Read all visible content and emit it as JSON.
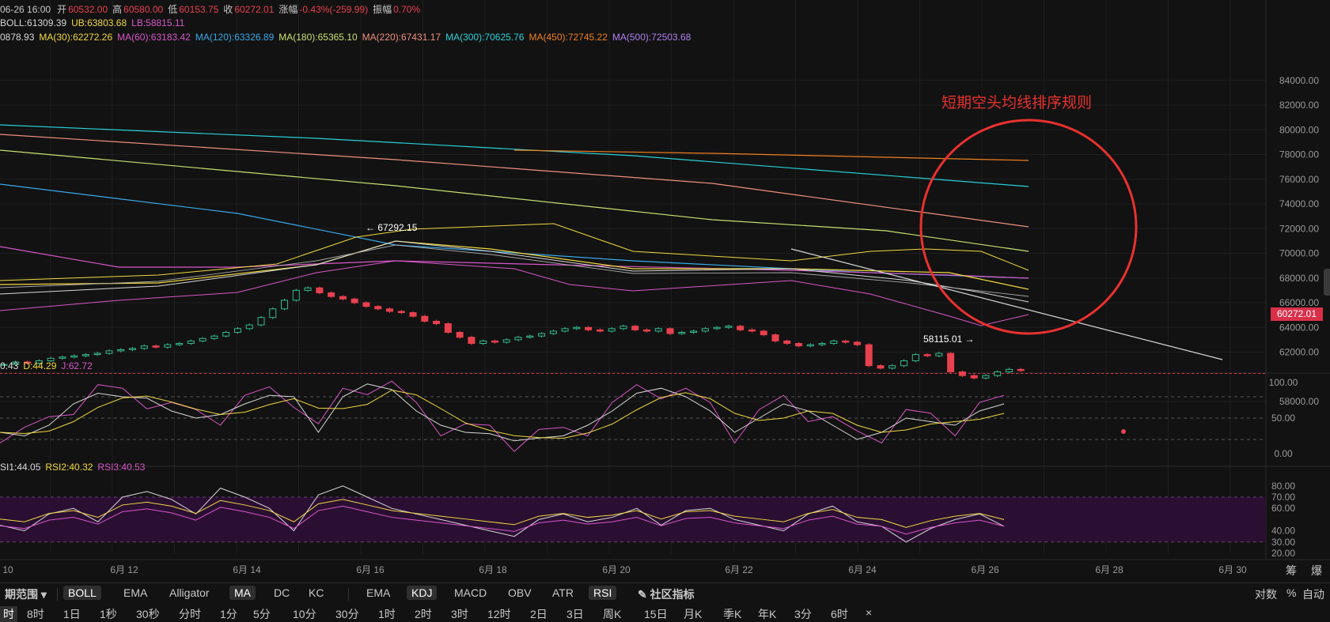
{
  "header": {
    "ohlc": [
      {
        "label": "06-26 16:00",
        "value": ""
      },
      {
        "label": "开",
        "value": "60532.00"
      },
      {
        "label": "高",
        "value": "60580.00"
      },
      {
        "label": "低",
        "value": "60153.75"
      },
      {
        "label": "收",
        "value": "60272.01"
      },
      {
        "label": "涨幅",
        "value": "-0.43%(-259.99)"
      },
      {
        "label": "振幅",
        "value": "0.70%"
      }
    ],
    "boll": [
      {
        "text": "BOLL:61309.39",
        "color": "#d8d8d8"
      },
      {
        "text": "UB:63803.68",
        "color": "#f0d840"
      },
      {
        "text": "LB:58815.11",
        "color": "#d857c8"
      }
    ],
    "ma": [
      {
        "text": "0878.93",
        "color": "#d8d8d8"
      },
      {
        "text": "MA(30):62272.26",
        "color": "#f0d840"
      },
      {
        "text": "MA(60):63183.42",
        "color": "#d857c8"
      },
      {
        "text": "MA(120):63326.89",
        "color": "#3aa8e8"
      },
      {
        "text": "MA(180):65365.10",
        "color": "#c8e070"
      },
      {
        "text": "MA(220):67431.17",
        "color": "#f09080"
      },
      {
        "text": "MA(300):70625.76",
        "color": "#28d0d8"
      },
      {
        "text": "MA(450):72745.22",
        "color": "#f08020"
      },
      {
        "text": "MA(500):72503.68",
        "color": "#b080f0"
      }
    ]
  },
  "kdj_legend": [
    {
      "text": "0.43",
      "color": "#d8d8d8"
    },
    {
      "text": "D:44.29",
      "color": "#f0d840"
    },
    {
      "text": "J:62.72",
      "color": "#d857c8"
    }
  ],
  "rsi_legend": [
    {
      "text": "SI1:44.05",
      "color": "#d8d8d8"
    },
    {
      "text": "RSI2:40.32",
      "color": "#f0d840"
    },
    {
      "text": "RSI3:40.53",
      "color": "#d857c8"
    }
  ],
  "annotation": "短期空头均线排序规则",
  "current_price": "60272.01",
  "high_marker": "← 67292.15",
  "low_marker": "58115.01 →",
  "price_axis": [
    "84000.00",
    "82000.00",
    "80000.00",
    "78000.00",
    "76000.00",
    "74000.00",
    "72000.00",
    "70000.00",
    "68000.00",
    "66000.00",
    "64000.00",
    "62000.00",
    "58000.00"
  ],
  "kdj_axis": [
    "100.00",
    "50.00",
    "0.00"
  ],
  "rsi_axis": [
    "80.00",
    "70.00",
    "60.00",
    "40.00",
    "30.00",
    "20.00"
  ],
  "date_axis": [
    "10",
    "6月 12",
    "6月 14",
    "6月 16",
    "6月 18",
    "6月 20",
    "6月 22",
    "6月 24",
    "6月 26",
    "6月 28",
    "6月 30"
  ],
  "axis_corner": [
    "筹",
    "爆"
  ],
  "toolbar": {
    "left_label": "期范围 ▾",
    "main_indicators": [
      {
        "label": "BOLL",
        "active": true
      },
      {
        "label": "EMA",
        "active": false
      },
      {
        "label": "Alligator",
        "active": false
      },
      {
        "label": "MA",
        "active": true
      },
      {
        "label": "DC",
        "active": false
      },
      {
        "label": "KC",
        "active": false
      }
    ],
    "sub_indicators": [
      {
        "label": "EMA",
        "active": false
      },
      {
        "label": "KDJ",
        "active": true
      },
      {
        "label": "MACD",
        "active": false
      },
      {
        "label": "OBV",
        "active": false
      },
      {
        "label": "ATR",
        "active": false
      },
      {
        "label": "RSI",
        "active": true
      }
    ],
    "community": "社区指标",
    "right": [
      "对数",
      "%",
      "自动"
    ]
  },
  "timeframes": [
    {
      "label": "时",
      "active": true
    },
    {
      "label": "8时",
      "active": false
    },
    {
      "label": "1日",
      "active": false
    },
    {
      "label": "1秒",
      "active": false
    },
    {
      "label": "30秒",
      "active": false
    },
    {
      "label": "分时",
      "active": false
    },
    {
      "label": "1分",
      "active": false
    },
    {
      "label": "5分",
      "active": false
    },
    {
      "label": "10分",
      "active": false
    },
    {
      "label": "30分",
      "active": false
    },
    {
      "label": "1时",
      "active": false
    },
    {
      "label": "2时",
      "active": false
    },
    {
      "label": "3时",
      "active": false
    },
    {
      "label": "12时",
      "active": false
    },
    {
      "label": "2日",
      "active": false
    },
    {
      "label": "3日",
      "active": false
    },
    {
      "label": "周K",
      "active": false
    },
    {
      "label": "15日",
      "active": false
    },
    {
      "label": "月K",
      "active": false
    },
    {
      "label": "季K",
      "active": false
    },
    {
      "label": "年K",
      "active": false
    },
    {
      "label": "3分",
      "active": false
    },
    {
      "label": "6时",
      "active": false
    },
    {
      "label": "×",
      "active": false
    }
  ]
}
